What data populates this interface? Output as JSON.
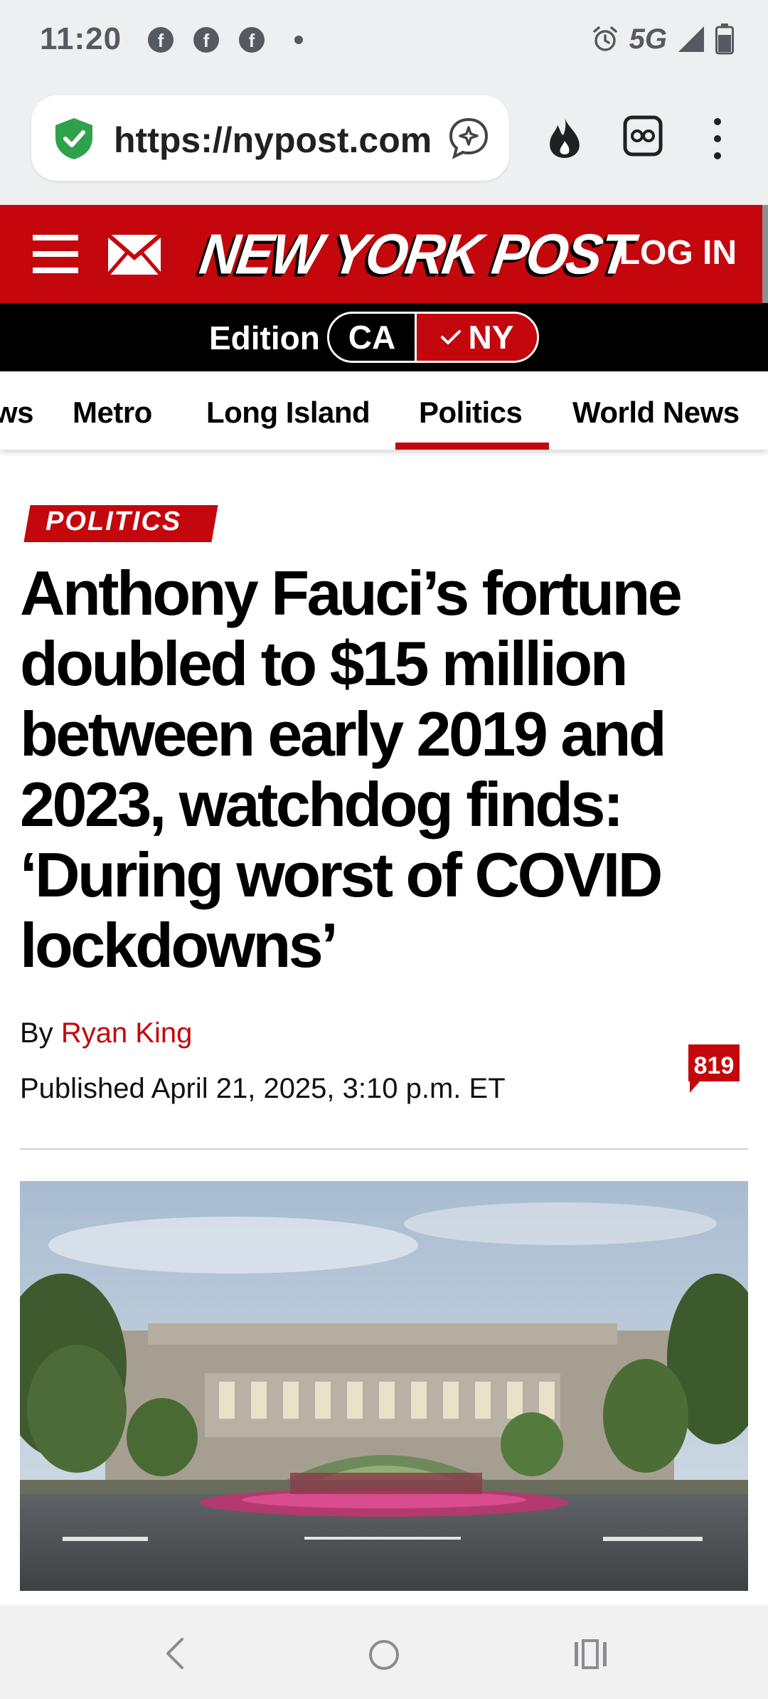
{
  "status_bar": {
    "time": "11:20",
    "notification_icons": [
      "facebook-icon",
      "facebook-icon",
      "facebook-icon"
    ],
    "network": "5G",
    "right_icons": [
      "alarm-icon",
      "signal-icon",
      "battery-icon"
    ]
  },
  "browser": {
    "url": "https://nypost.com",
    "icons": [
      "secure-shield-icon",
      "assistant-icon",
      "flame-icon",
      "tab-switcher-icon",
      "more-vert-icon"
    ]
  },
  "header": {
    "logo": "NEW YORK POST",
    "login_label": "LOG IN",
    "brand_color": "#c4070c"
  },
  "edition": {
    "label": "Edition",
    "options": [
      "CA",
      "NY"
    ],
    "selected": "NY"
  },
  "nav": {
    "items": [
      "ws",
      "Metro",
      "Long Island",
      "Politics",
      "World News"
    ],
    "active": "Politics"
  },
  "article": {
    "category": "POLITICS",
    "headline": "Anthony Fauci’s fortune doubled to $15 million between early 2019 and 2023, watchdog finds: ‘During worst of COVID lockdowns’",
    "byline_prefix": "By",
    "author": "Ryan King",
    "published": "Published April 21, 2025, 3:10 p.m. ET",
    "comment_count": "819"
  },
  "system_nav": {
    "icons": [
      "back-icon",
      "home-icon",
      "recents-icon"
    ]
  }
}
